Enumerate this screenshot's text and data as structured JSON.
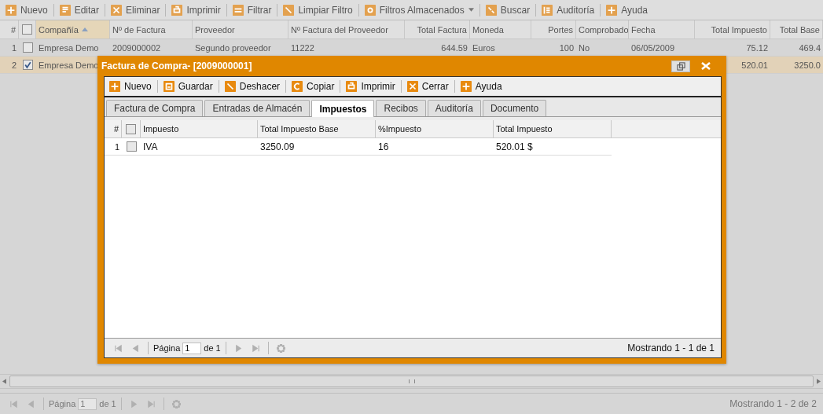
{
  "toolbar": [
    {
      "label": "Nuevo",
      "kind": "plus",
      "dropdown": false
    },
    {
      "label": "Editar",
      "kind": "edit",
      "dropdown": false
    },
    {
      "label": "Eliminar",
      "kind": "delete",
      "dropdown": false
    },
    {
      "label": "Imprimir",
      "kind": "print",
      "dropdown": false
    },
    {
      "label": "Filtrar",
      "kind": "filter",
      "dropdown": false
    },
    {
      "label": "Limpiar Filtro",
      "kind": "clear",
      "dropdown": false
    },
    {
      "label": "Filtros Almacenados",
      "kind": "stored",
      "dropdown": true
    },
    {
      "label": "Buscar",
      "kind": "search",
      "dropdown": false
    },
    {
      "label": "Auditoría",
      "kind": "audit",
      "dropdown": false
    },
    {
      "label": "Ayuda",
      "kind": "plus",
      "dropdown": false
    }
  ],
  "grid": {
    "number_header": "#",
    "all_checked": false,
    "columns": [
      {
        "label": "Compañía",
        "sorted": true,
        "numeric": false
      },
      {
        "label": "Nº de Factura",
        "sorted": false,
        "numeric": false
      },
      {
        "label": "Proveedor",
        "sorted": false,
        "numeric": false
      },
      {
        "label": "Nº Factura del Proveedor",
        "sorted": false,
        "numeric": false
      },
      {
        "label": "Total Factura",
        "sorted": false,
        "numeric": true
      },
      {
        "label": "Moneda",
        "sorted": false,
        "numeric": false
      },
      {
        "label": "Portes",
        "sorted": false,
        "numeric": true
      },
      {
        "label": "Comprobado",
        "sorted": false,
        "numeric": false
      },
      {
        "label": "Fecha",
        "sorted": false,
        "numeric": false
      },
      {
        "label": "Total Impuesto",
        "sorted": false,
        "numeric": true
      },
      {
        "label": "Total Base",
        "sorted": false,
        "numeric": true
      }
    ],
    "rows": [
      {
        "number": "1",
        "checked": false,
        "selected": false,
        "cells": [
          "Empresa Demo",
          "2009000002",
          "Segundo proveedor",
          "11222",
          "644.59",
          "Euros",
          "100",
          "No",
          "06/05/2009",
          "75.12",
          "469.4"
        ]
      },
      {
        "number": "2",
        "checked": true,
        "selected": true,
        "cells": [
          "Empresa Demo",
          null,
          null,
          null,
          null,
          null,
          null,
          null,
          null,
          "520.01",
          "3250.0"
        ]
      }
    ]
  },
  "paging": {
    "page_label": "Página",
    "page": "1",
    "of": "de 1",
    "summary": "Mostrando 1 - 2 de 2"
  },
  "dialog": {
    "title": "Factura de Compra- [2009000001]",
    "toolbar": [
      {
        "label": "Nuevo",
        "kind": "plus"
      },
      {
        "label": "Guardar",
        "kind": "save"
      },
      {
        "label": "Deshacer",
        "kind": "clear"
      },
      {
        "label": "Copiar",
        "kind": "copy"
      },
      {
        "label": "Imprimir",
        "kind": "print"
      },
      {
        "label": "Cerrar",
        "kind": "delete"
      },
      {
        "label": "Ayuda",
        "kind": "plus"
      }
    ],
    "tabs": [
      {
        "label": "Factura de Compra",
        "selected": false
      },
      {
        "label": "Entradas de Almacén",
        "selected": false
      },
      {
        "label": "Impuestos",
        "selected": true
      },
      {
        "label": "Recibos",
        "selected": false
      },
      {
        "label": "Auditoría",
        "selected": false
      },
      {
        "label": "Documento",
        "selected": false
      }
    ],
    "number_header": "#",
    "all_checked": false,
    "columns": [
      "Impuesto",
      "Total Impuesto Base",
      "%Impuesto",
      "Total Impuesto"
    ],
    "rows": [
      {
        "number": "1",
        "checked": false,
        "cells": [
          "IVA",
          "3250.09",
          "16",
          "520.01 $"
        ]
      }
    ],
    "paging": {
      "page_label": "Página",
      "page": "1",
      "of": "de 1",
      "summary": "Mostrando 1 - 1 de 1"
    }
  }
}
